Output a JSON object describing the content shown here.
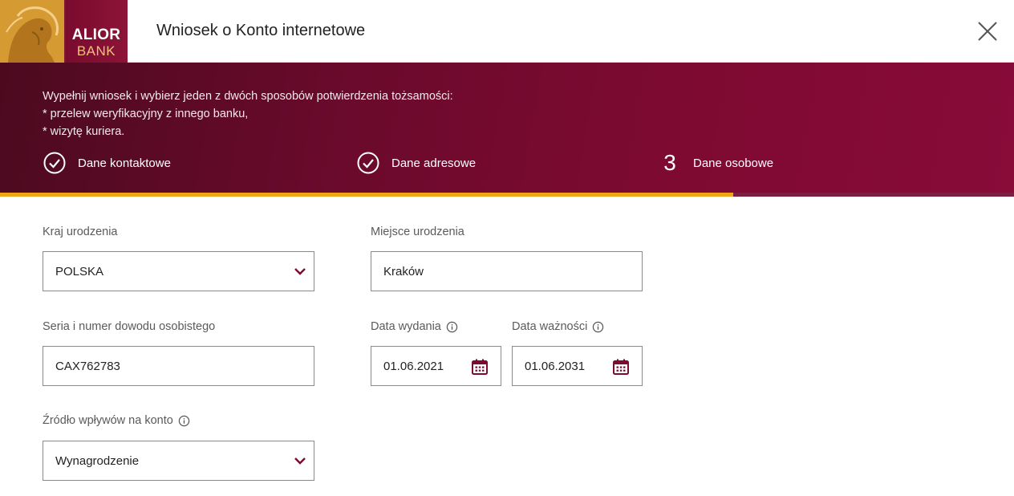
{
  "header": {
    "logo_line1": "ALIOR",
    "logo_line2": "BANK",
    "title": "Wniosek o Konto internetowe",
    "close_icon": "close-icon"
  },
  "banner": {
    "intro_line1": "Wypełnij wniosek i wybierz jeden z dwóch sposobów potwierdzenia tożsamości:",
    "intro_line2": "* przelew weryfikacyjny z innego banku,",
    "intro_line3": "* wizytę kuriera.",
    "steps": [
      {
        "label": "Dane kontaktowe",
        "state": "done",
        "icon": "check-circle-icon"
      },
      {
        "label": "Dane adresowe",
        "state": "done",
        "icon": "check-circle-icon"
      },
      {
        "number": "3",
        "label": "Dane osobowe",
        "state": "active"
      }
    ],
    "progress_fraction": 0.723
  },
  "form": {
    "birth_country": {
      "label": "Kraj urodzenia",
      "value": "POLSKA"
    },
    "birth_place": {
      "label": "Miejsce urodzenia",
      "value": "Kraków"
    },
    "id_number": {
      "label": "Seria i numer dowodu osobistego",
      "value": "CAX762783"
    },
    "issue_date": {
      "label": "Data wydania",
      "value": "01.06.2021"
    },
    "expiry_date": {
      "label": "Data ważności",
      "value": "01.06.2031"
    },
    "income_source": {
      "label": "Źródło wpływów na konto",
      "value": "Wynagrodzenie"
    }
  },
  "colors": {
    "brand": "#7d0a31",
    "accent": "#f2a517",
    "chevron": "#7d0a31"
  }
}
